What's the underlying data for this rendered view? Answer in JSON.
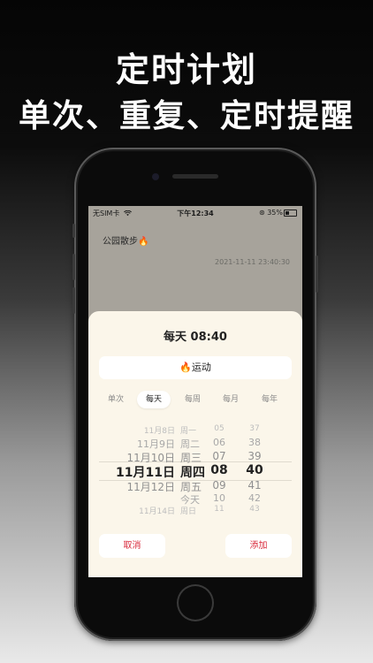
{
  "headline": {
    "line1": "定时计划",
    "line2": "单次、重复、定时提醒"
  },
  "status_bar": {
    "carrier": "无SIM卡",
    "time": "下午12:34",
    "battery": "35%"
  },
  "plan": {
    "title": "公园散步🔥",
    "datetime": "2021-11-11 23:40:30"
  },
  "sheet": {
    "title": "每天 08:40",
    "category": "🔥运动",
    "tabs": [
      {
        "label": "单次",
        "active": false
      },
      {
        "label": "每天",
        "active": true
      },
      {
        "label": "每周",
        "active": false
      },
      {
        "label": "每月",
        "active": false
      },
      {
        "label": "每年",
        "active": false
      }
    ],
    "picker_rows": [
      {
        "date": "11月8日",
        "weekday": "周一",
        "hour": "05",
        "minute": "37"
      },
      {
        "date": "11月9日",
        "weekday": "周二",
        "hour": "06",
        "minute": "38"
      },
      {
        "date": "11月10日",
        "weekday": "周三",
        "hour": "07",
        "minute": "39"
      },
      {
        "date": "11月11日",
        "weekday": "周四",
        "hour": "08",
        "minute": "40"
      },
      {
        "date": "11月12日",
        "weekday": "周五",
        "hour": "09",
        "minute": "41"
      },
      {
        "date": "",
        "weekday": "今天",
        "hour": "10",
        "minute": "42"
      },
      {
        "date": "11月14日",
        "weekday": "周日",
        "hour": "11",
        "minute": "43"
      }
    ],
    "cancel_label": "取消",
    "add_label": "添加"
  }
}
